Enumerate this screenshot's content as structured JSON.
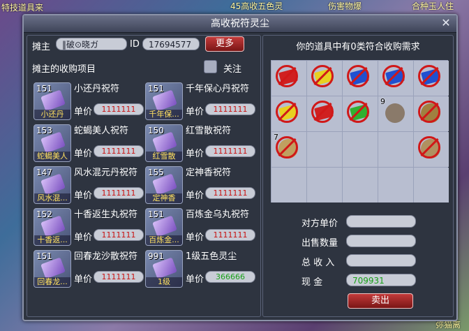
{
  "window": {
    "title": "高收祝符灵尘",
    "close": "✕"
  },
  "background": {
    "texts": [
      "特技道具来",
      "45高收五色灵",
      "伤害物爆",
      "合种玉人住",
      "弥猫离"
    ]
  },
  "seller": {
    "label": "摊主",
    "name": "‖破⊙晓ガ",
    "id_label": "ID",
    "id": "17694577",
    "more": "更多"
  },
  "left": {
    "heading": "摊主的收购项目",
    "follow": "关注",
    "price_label": "单价"
  },
  "items": [
    {
      "level": "151",
      "tag": "小还丹",
      "name": "小还丹祝符",
      "price": "1111111"
    },
    {
      "level": "151",
      "tag": "千年保...",
      "name": "千年保心丹祝符",
      "price": "1111111"
    },
    {
      "level": "153",
      "tag": "蛇蝎美人",
      "name": "蛇蝎美人祝符",
      "price": "1111111"
    },
    {
      "level": "150",
      "tag": "红雪散",
      "name": "红雪散祝符",
      "price": "1111111"
    },
    {
      "level": "147",
      "tag": "风水混...",
      "name": "风水混元丹祝符",
      "price": "1111111"
    },
    {
      "level": "155",
      "tag": "定神香",
      "name": "定神香祝符",
      "price": "1111111"
    },
    {
      "level": "152",
      "tag": "十香返...",
      "name": "十香返生丸祝符",
      "price": "1111111"
    },
    {
      "level": "151",
      "tag": "百炼金...",
      "name": "百炼金乌丸祝符",
      "price": "1111111"
    },
    {
      "level": "151",
      "tag": "回春龙...",
      "name": "回春龙沙散祝符",
      "price": "1111111"
    },
    {
      "level": "991",
      "tag": "1级",
      "name": "1级五色灵尘",
      "price": "366666"
    }
  ],
  "right": {
    "heading": "你的道具中有0类符合收购需求",
    "inventory": [
      {
        "type": "flag",
        "color": "#d02020",
        "blocked": true
      },
      {
        "type": "flag",
        "color": "#e8d020",
        "blocked": true
      },
      {
        "type": "flag",
        "color": "#2050d0",
        "blocked": true
      },
      {
        "type": "flag",
        "color": "#2050d0",
        "blocked": true
      },
      {
        "type": "flag",
        "color": "#2050d0",
        "blocked": true
      },
      {
        "type": "flag",
        "color": "#e8d020",
        "blocked": true
      },
      {
        "type": "flag",
        "color": "#d02020",
        "blocked": true
      },
      {
        "type": "flag",
        "color": "#30b030",
        "blocked": true
      },
      {
        "type": "item",
        "color": "#8a7a6a",
        "blocked": false,
        "count": "9"
      },
      {
        "type": "item",
        "color": "#a08040",
        "blocked": true
      },
      {
        "type": "item",
        "color": "#c0a060",
        "blocked": true,
        "count": "7"
      },
      {
        "type": "empty"
      },
      {
        "type": "empty"
      },
      {
        "type": "empty"
      },
      {
        "type": "item",
        "color": "#b09060",
        "blocked": true
      },
      {
        "type": "empty"
      },
      {
        "type": "empty"
      },
      {
        "type": "empty"
      },
      {
        "type": "empty"
      },
      {
        "type": "empty"
      }
    ],
    "unit_price_label": "对方单价",
    "unit_price": "",
    "quantity_label": "出售数量",
    "quantity": "",
    "income_label": "总 收 入",
    "income": "",
    "cash_label": "现 金",
    "cash": "709931",
    "sell": "卖出"
  }
}
